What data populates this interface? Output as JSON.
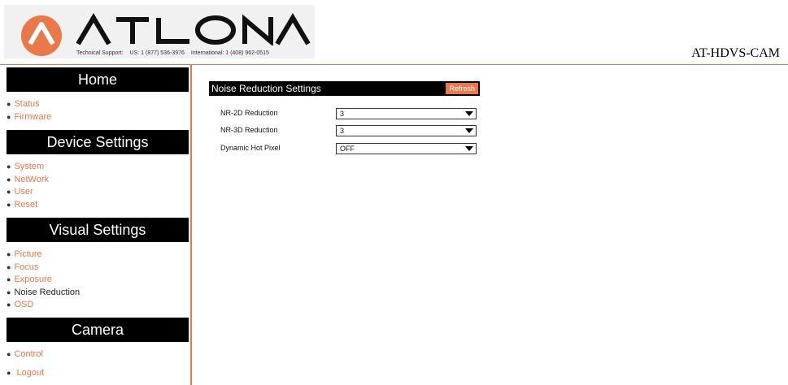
{
  "header": {
    "logo_text": "ATLONA",
    "support_label": "Technical Support:",
    "support_us": "US: 1 (877) 536-3976",
    "support_intl": "International: 1 (408) 962-0515",
    "model": "AT-HDVS-CAM"
  },
  "sidebar": {
    "home": {
      "title": "Home",
      "items": [
        {
          "label": "Status"
        },
        {
          "label": "Firmware"
        }
      ]
    },
    "device": {
      "title": "Device Settings",
      "items": [
        {
          "label": "System"
        },
        {
          "label": "NetWork"
        },
        {
          "label": "User"
        },
        {
          "label": "Reset"
        }
      ]
    },
    "visual": {
      "title": "Visual Settings",
      "items": [
        {
          "label": "Picture"
        },
        {
          "label": "Focus"
        },
        {
          "label": "Exposure"
        },
        {
          "label": "Noise Reduction"
        },
        {
          "label": "OSD"
        }
      ]
    },
    "camera": {
      "title": "Camera",
      "items": [
        {
          "label": "Control"
        }
      ]
    },
    "logout": "Logout"
  },
  "main": {
    "title": "Noise Reduction Settings",
    "refresh_label": "Refresh",
    "fields": [
      {
        "label": "NR-2D Reduction",
        "value": "3"
      },
      {
        "label": "NR-3D Reduction",
        "value": "3"
      },
      {
        "label": "Dynamic Hot Pixel",
        "value": "OFF"
      }
    ]
  },
  "colors": {
    "accent": "#e9784b",
    "header_bg": "#000000"
  }
}
